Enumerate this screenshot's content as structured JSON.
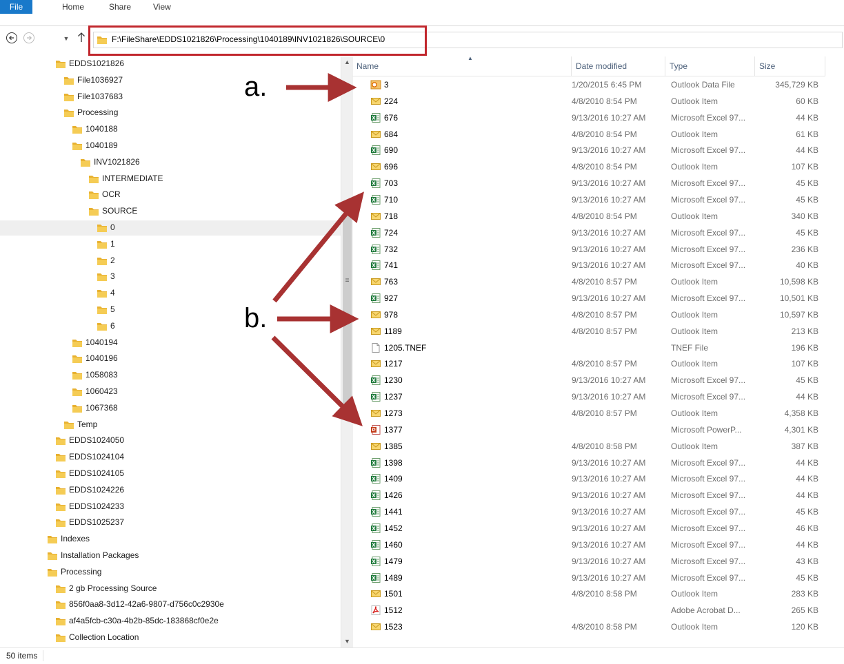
{
  "ribbon": {
    "file": "File",
    "home": "Home",
    "share": "Share",
    "view": "View"
  },
  "address": {
    "path": "F:\\FileShare\\EDDS1021826\\Processing\\1040189\\INV1021826\\SOURCE\\0"
  },
  "tree": [
    {
      "label": "EDDS1021826",
      "indent": 1
    },
    {
      "label": "File1036927",
      "indent": 2
    },
    {
      "label": "File1037683",
      "indent": 2
    },
    {
      "label": "Processing",
      "indent": 2
    },
    {
      "label": "1040188",
      "indent": 3
    },
    {
      "label": "1040189",
      "indent": 3
    },
    {
      "label": "INV1021826",
      "indent": 4
    },
    {
      "label": "INTERMEDIATE",
      "indent": 5
    },
    {
      "label": "OCR",
      "indent": 5
    },
    {
      "label": "SOURCE",
      "indent": 5
    },
    {
      "label": "0",
      "indent": 6,
      "selected": true
    },
    {
      "label": "1",
      "indent": 6
    },
    {
      "label": "2",
      "indent": 6
    },
    {
      "label": "3",
      "indent": 6
    },
    {
      "label": "4",
      "indent": 6
    },
    {
      "label": "5",
      "indent": 6
    },
    {
      "label": "6",
      "indent": 6
    },
    {
      "label": "1040194",
      "indent": 3
    },
    {
      "label": "1040196",
      "indent": 3
    },
    {
      "label": "1058083",
      "indent": 3
    },
    {
      "label": "1060423",
      "indent": 3
    },
    {
      "label": "1067368",
      "indent": 3
    },
    {
      "label": "Temp",
      "indent": 2
    },
    {
      "label": "EDDS1024050",
      "indent": 1
    },
    {
      "label": "EDDS1024104",
      "indent": 1
    },
    {
      "label": "EDDS1024105",
      "indent": 1
    },
    {
      "label": "EDDS1024226",
      "indent": 1
    },
    {
      "label": "EDDS1024233",
      "indent": 1
    },
    {
      "label": "EDDS1025237",
      "indent": 1
    },
    {
      "label": "Indexes",
      "indent": 0
    },
    {
      "label": "Installation Packages",
      "indent": 0
    },
    {
      "label": "Processing",
      "indent": 0
    },
    {
      "label": "2 gb Processing Source",
      "indent": 1
    },
    {
      "label": "856f0aa8-3d12-42a6-9807-d756c0c2930e",
      "indent": 1
    },
    {
      "label": "af4a5fcb-c30a-4b2b-85dc-183868cf0e2e",
      "indent": 1
    },
    {
      "label": "Collection Location",
      "indent": 1
    }
  ],
  "columns": {
    "name": "Name",
    "date": "Date modified",
    "type": "Type",
    "size": "Size"
  },
  "files": [
    {
      "name": "3",
      "date": "1/20/2015 6:45 PM",
      "type": "Outlook Data File",
      "size": "345,729 KB",
      "icon": "pst"
    },
    {
      "name": "224",
      "date": "4/8/2010 8:54 PM",
      "type": "Outlook Item",
      "size": "60 KB",
      "icon": "msg"
    },
    {
      "name": "676",
      "date": "9/13/2016 10:27 AM",
      "type": "Microsoft Excel 97...",
      "size": "44 KB",
      "icon": "xls"
    },
    {
      "name": "684",
      "date": "4/8/2010 8:54 PM",
      "type": "Outlook Item",
      "size": "61 KB",
      "icon": "msg"
    },
    {
      "name": "690",
      "date": "9/13/2016 10:27 AM",
      "type": "Microsoft Excel 97...",
      "size": "44 KB",
      "icon": "xls"
    },
    {
      "name": "696",
      "date": "4/8/2010 8:54 PM",
      "type": "Outlook Item",
      "size": "107 KB",
      "icon": "msg"
    },
    {
      "name": "703",
      "date": "9/13/2016 10:27 AM",
      "type": "Microsoft Excel 97...",
      "size": "45 KB",
      "icon": "xls"
    },
    {
      "name": "710",
      "date": "9/13/2016 10:27 AM",
      "type": "Microsoft Excel 97...",
      "size": "45 KB",
      "icon": "xls"
    },
    {
      "name": "718",
      "date": "4/8/2010 8:54 PM",
      "type": "Outlook Item",
      "size": "340 KB",
      "icon": "msg"
    },
    {
      "name": "724",
      "date": "9/13/2016 10:27 AM",
      "type": "Microsoft Excel 97...",
      "size": "45 KB",
      "icon": "xls"
    },
    {
      "name": "732",
      "date": "9/13/2016 10:27 AM",
      "type": "Microsoft Excel 97...",
      "size": "236 KB",
      "icon": "xls"
    },
    {
      "name": "741",
      "date": "9/13/2016 10:27 AM",
      "type": "Microsoft Excel 97...",
      "size": "40 KB",
      "icon": "xls"
    },
    {
      "name": "763",
      "date": "4/8/2010 8:57 PM",
      "type": "Outlook Item",
      "size": "10,598 KB",
      "icon": "msg"
    },
    {
      "name": "927",
      "date": "9/13/2016 10:27 AM",
      "type": "Microsoft Excel 97...",
      "size": "10,501 KB",
      "icon": "xls"
    },
    {
      "name": "978",
      "date": "4/8/2010 8:57 PM",
      "type": "Outlook Item",
      "size": "10,597 KB",
      "icon": "msg"
    },
    {
      "name": "1189",
      "date": "4/8/2010 8:57 PM",
      "type": "Outlook Item",
      "size": "213 KB",
      "icon": "msg"
    },
    {
      "name": "1205.TNEF",
      "date": "",
      "type": "TNEF File",
      "size": "196 KB",
      "icon": "blank"
    },
    {
      "name": "1217",
      "date": "4/8/2010 8:57 PM",
      "type": "Outlook Item",
      "size": "107 KB",
      "icon": "msg"
    },
    {
      "name": "1230",
      "date": "9/13/2016 10:27 AM",
      "type": "Microsoft Excel 97...",
      "size": "45 KB",
      "icon": "xls"
    },
    {
      "name": "1237",
      "date": "9/13/2016 10:27 AM",
      "type": "Microsoft Excel 97...",
      "size": "44 KB",
      "icon": "xls"
    },
    {
      "name": "1273",
      "date": "4/8/2010 8:57 PM",
      "type": "Outlook Item",
      "size": "4,358 KB",
      "icon": "msg"
    },
    {
      "name": "1377",
      "date": "",
      "type": "Microsoft PowerP...",
      "size": "4,301 KB",
      "icon": "ppt"
    },
    {
      "name": "1385",
      "date": "4/8/2010 8:58 PM",
      "type": "Outlook Item",
      "size": "387 KB",
      "icon": "msg"
    },
    {
      "name": "1398",
      "date": "9/13/2016 10:27 AM",
      "type": "Microsoft Excel 97...",
      "size": "44 KB",
      "icon": "xls"
    },
    {
      "name": "1409",
      "date": "9/13/2016 10:27 AM",
      "type": "Microsoft Excel 97...",
      "size": "44 KB",
      "icon": "xls"
    },
    {
      "name": "1426",
      "date": "9/13/2016 10:27 AM",
      "type": "Microsoft Excel 97...",
      "size": "44 KB",
      "icon": "xls"
    },
    {
      "name": "1441",
      "date": "9/13/2016 10:27 AM",
      "type": "Microsoft Excel 97...",
      "size": "45 KB",
      "icon": "xls"
    },
    {
      "name": "1452",
      "date": "9/13/2016 10:27 AM",
      "type": "Microsoft Excel 97...",
      "size": "46 KB",
      "icon": "xls"
    },
    {
      "name": "1460",
      "date": "9/13/2016 10:27 AM",
      "type": "Microsoft Excel 97...",
      "size": "44 KB",
      "icon": "xls"
    },
    {
      "name": "1479",
      "date": "9/13/2016 10:27 AM",
      "type": "Microsoft Excel 97...",
      "size": "43 KB",
      "icon": "xls"
    },
    {
      "name": "1489",
      "date": "9/13/2016 10:27 AM",
      "type": "Microsoft Excel 97...",
      "size": "45 KB",
      "icon": "xls"
    },
    {
      "name": "1501",
      "date": "4/8/2010 8:58 PM",
      "type": "Outlook Item",
      "size": "283 KB",
      "icon": "msg"
    },
    {
      "name": "1512",
      "date": "",
      "type": "Adobe Acrobat D...",
      "size": "265 KB",
      "icon": "pdf"
    },
    {
      "name": "1523",
      "date": "4/8/2010 8:58 PM",
      "type": "Outlook Item",
      "size": "120 KB",
      "icon": "msg"
    }
  ],
  "status": {
    "count": "50 items"
  },
  "annotations": {
    "a": "a.",
    "b": "b."
  },
  "colors": {
    "accent": "#1979ca",
    "annotation": "#a83232",
    "folder": "#e8b130"
  }
}
